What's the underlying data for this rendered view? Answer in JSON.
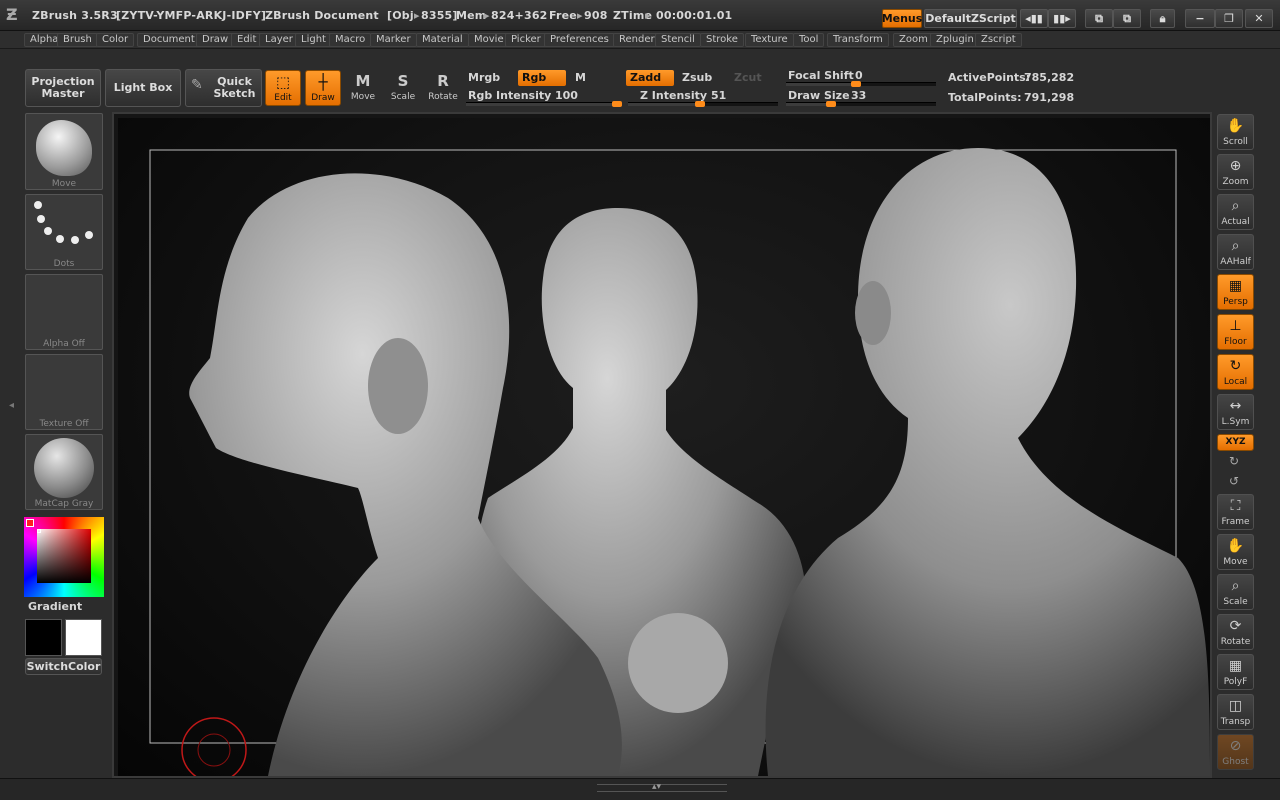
{
  "titlebar": {
    "app_version": "ZBrush 3.5R3",
    "serial": "[ZYTV-YMFP-ARKJ-IDFY]",
    "document": "ZBrush Document",
    "obj": "[Obj",
    "obj_val": "8355]",
    "mem": "Mem",
    "mem_val": "824+362",
    "free": "Free",
    "free_val": "908",
    "ztime": "ZTime",
    "ztime_val": "00:00:01.01",
    "menus_label": "Menus",
    "zscript_label": "DefaultZScript"
  },
  "menubar": {
    "items": [
      "Alpha",
      "Brush",
      "Color",
      "Document",
      "Draw",
      "Edit",
      "Layer",
      "Light",
      "Macro",
      "Marker",
      "Material",
      "Movie",
      "Picker",
      "Preferences",
      "Render",
      "Stencil",
      "Stroke",
      "Texture",
      "Tool",
      "Transform",
      "Zoom",
      "Zplugin",
      "Zscript"
    ]
  },
  "toolbar": {
    "projection_master": "Projection Master",
    "light_box": "Light Box",
    "quick_sketch": "Quick Sketch",
    "edit": "Edit",
    "draw": "Draw",
    "move": "Move",
    "scale": "Scale",
    "rotate": "Rotate",
    "mrgb": "Mrgb",
    "rgb": "Rgb",
    "m": "M",
    "zadd": "Zadd",
    "zsub": "Zsub",
    "zcut": "Zcut",
    "rgb_intensity_label": "Rgb Intensity",
    "rgb_intensity_value": "100",
    "rgb_intensity_fraction": 1.0,
    "z_intensity_label": "Z Intensity",
    "z_intensity_value": "51",
    "z_intensity_fraction": 0.51,
    "focal_shift_label": "Focal Shift",
    "focal_shift_value": "0",
    "focal_shift_fraction": 0.5,
    "draw_size_label": "Draw Size",
    "draw_size_value": "33",
    "draw_size_fraction": 0.33,
    "active_points_label": "ActivePoints:",
    "active_points_value": "785,282",
    "total_points_label": "TotalPoints:",
    "total_points_value": "791,298"
  },
  "left_panel": {
    "brush_caption": "Move",
    "stroke_caption": "Dots",
    "alpha_caption": "Alpha Off",
    "texture_caption": "Texture Off",
    "material_caption": "MatCap Gray",
    "gradient_label": "Gradient",
    "switch_color_label": "SwitchColor"
  },
  "right_panel": {
    "scroll": "Scroll",
    "zoom": "Zoom",
    "actual": "Actual",
    "aahalf": "AAHalf",
    "persp": "Persp",
    "floor": "Floor",
    "local": "Local",
    "lsym": "L.Sym",
    "xyz": "XYZ",
    "frame": "Frame",
    "move": "Move",
    "scale": "Scale",
    "rotate": "Rotate",
    "polyf": "PolyF",
    "transp": "Transp",
    "ghost": "Ghost"
  },
  "colors": {
    "accent": "#f07d0a",
    "panel": "#2c2c2c",
    "canvas": "#111111"
  }
}
